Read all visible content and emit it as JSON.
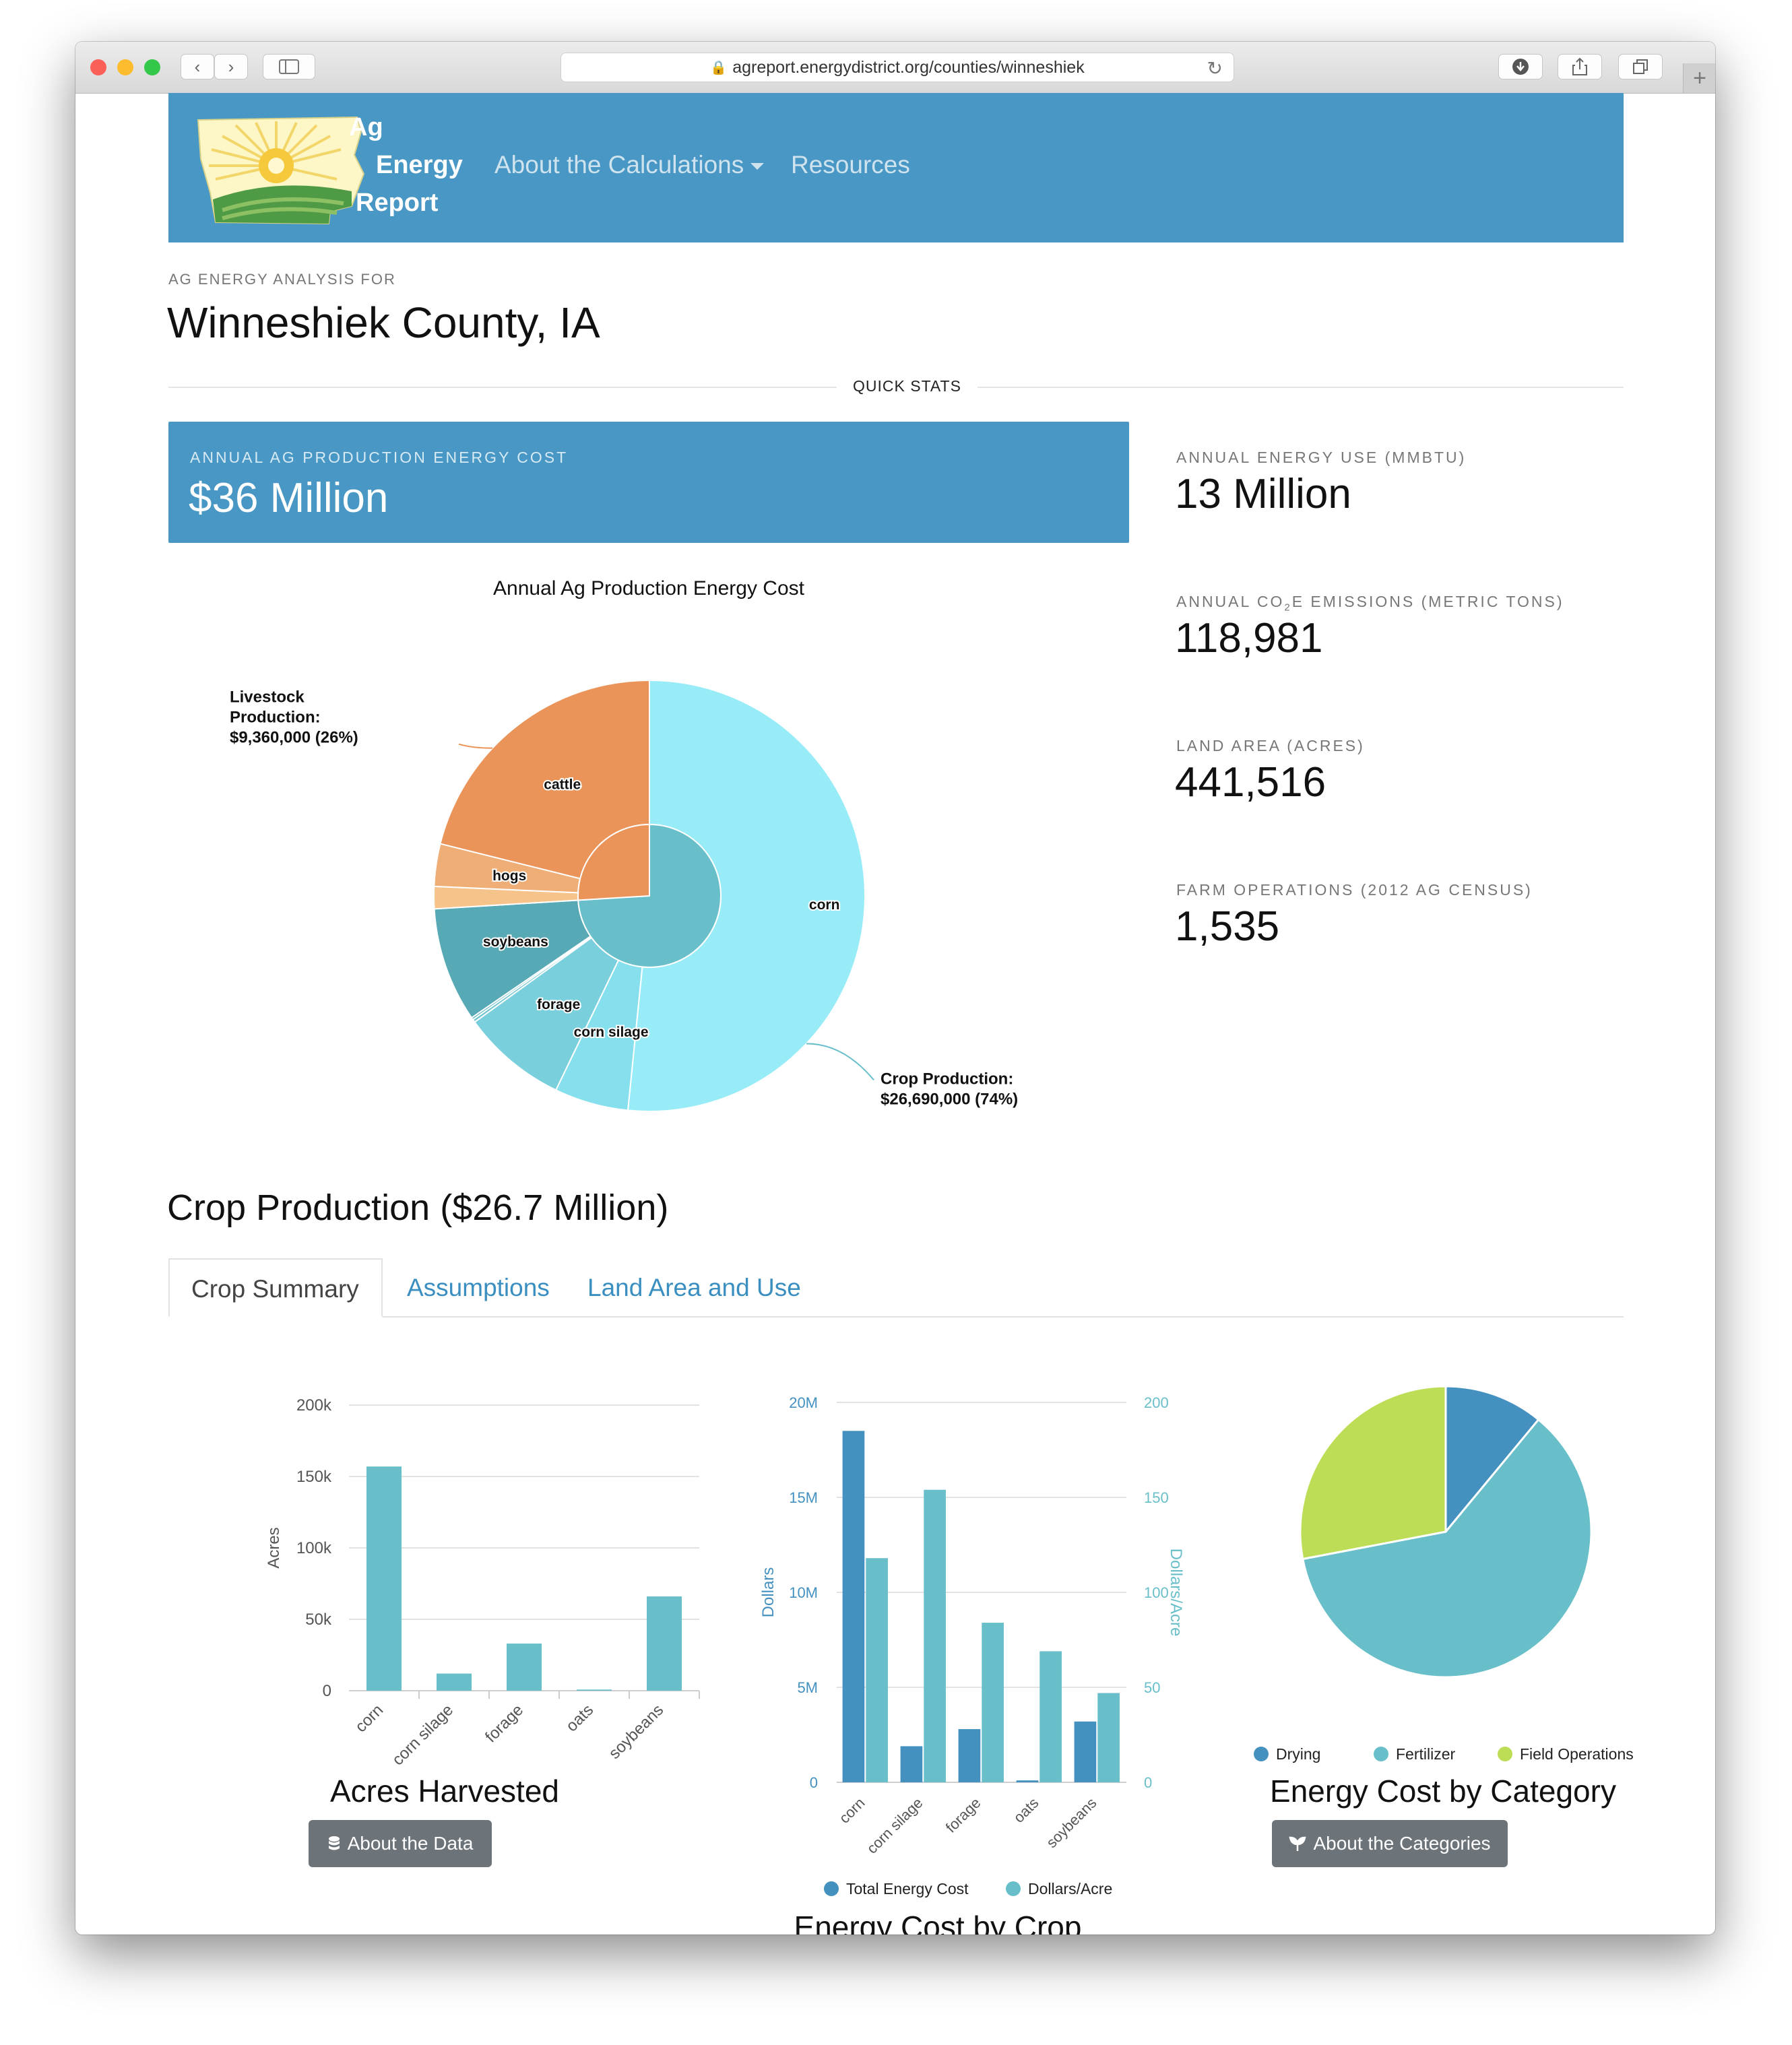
{
  "browser": {
    "url": "agreport.energydistrict.org/counties/winneshiek"
  },
  "nav": {
    "logo_words": [
      "Ag",
      "Energy",
      "Report"
    ],
    "links": [
      {
        "label": "About the Calculations"
      },
      {
        "label": "Resources"
      }
    ]
  },
  "header": {
    "kicker": "AG ENERGY ANALYSIS FOR",
    "title": "Winneshiek County, IA",
    "quick_stats_label": "QUICK STATS"
  },
  "cost_banner": {
    "label": "ANNUAL AG PRODUCTION ENERGY COST",
    "value": "$36 Million"
  },
  "stats": [
    {
      "label": "ANNUAL ENERGY USE (MMBTU)",
      "value": "13 Million"
    },
    {
      "label_parts": [
        "ANNUAL CO",
        "2",
        "E EMISSIONS (METRIC TONS)"
      ],
      "value": "118,981"
    },
    {
      "label": "LAND AREA (ACRES)",
      "value": "441,516"
    },
    {
      "label": "FARM OPERATIONS (2012 AG CENSUS)",
      "value": "1,535"
    }
  ],
  "crop_section": {
    "title": "Crop Production ($26.7 Million)",
    "tabs": [
      {
        "label": "Crop Summary",
        "active": true
      },
      {
        "label": "Assumptions",
        "active": false
      },
      {
        "label": "Land Area and Use",
        "active": false
      }
    ],
    "acres_caption": "Acres Harvested",
    "about_data_button": "About the Data",
    "energy_crop_caption": "Energy Cost by Crop",
    "category_caption": "Energy Cost by Category",
    "about_categories_button": "About the Categories"
  },
  "colors": {
    "brand_blue": "#4897c4",
    "teal": "#68bfc9",
    "dark_blue": "#4491c0",
    "lime": "#bddd56",
    "orange": "#ea9459",
    "light_cyan": "#98ecf8"
  },
  "chart_data": [
    {
      "type": "pie",
      "title": "Annual Ag Production Energy Cost",
      "inner": [
        {
          "name": "Crop Production",
          "value": 26690000,
          "label": "Crop Production:\n$26,690,000 (74%)"
        },
        {
          "name": "Livestock Production",
          "value": 9360000,
          "label": "Livestock\nProduction:\n$9,360,000 (26%)"
        }
      ],
      "outer": [
        {
          "name": "corn",
          "group": "Crop Production",
          "value": 18600000,
          "labeled": true
        },
        {
          "name": "corn silage",
          "group": "Crop Production",
          "value": 2000000,
          "labeled": true
        },
        {
          "name": "forage",
          "group": "Crop Production",
          "value": 2850000,
          "labeled": true
        },
        {
          "name": "oats",
          "group": "Crop Production",
          "value": 80000,
          "labeled": false
        },
        {
          "name": "",
          "group": "Crop Production",
          "value": 60000,
          "labeled": false
        },
        {
          "name": "soybeans",
          "group": "Crop Production",
          "value": 3100000,
          "labeled": true
        },
        {
          "name": "",
          "group": "Livestock Production",
          "value": 600000,
          "labeled": false
        },
        {
          "name": "hogs",
          "group": "Livestock Production",
          "value": 1150000,
          "labeled": true
        },
        {
          "name": "cattle",
          "group": "Livestock Production",
          "value": 7610000,
          "labeled": true
        }
      ]
    },
    {
      "type": "bar",
      "categories": [
        "corn",
        "corn silage",
        "forage",
        "oats",
        "soybeans"
      ],
      "values": [
        157000,
        12000,
        33000,
        800,
        66000
      ],
      "ylabel": "Acres",
      "ylim": [
        0,
        200000
      ],
      "yticks": [
        "0",
        "50k",
        "100k",
        "150k",
        "200k"
      ]
    },
    {
      "type": "bar",
      "categories": [
        "corn",
        "corn silage",
        "forage",
        "oats",
        "soybeans"
      ],
      "series": [
        {
          "name": "Total Energy Cost",
          "axis": "left",
          "values": [
            18500000,
            1900000,
            2800000,
            100000,
            3200000
          ]
        },
        {
          "name": "Dollars/Acre",
          "axis": "right",
          "values": [
            118,
            154,
            84,
            69,
            47
          ]
        }
      ],
      "ylabel_left": "Dollars",
      "ylabel_right": "Dollars/Acre",
      "ylim_left": [
        0,
        20000000
      ],
      "ylim_right": [
        0,
        200
      ],
      "yticks_left": [
        "0",
        "5M",
        "10M",
        "15M",
        "20M"
      ],
      "yticks_right": [
        "0",
        "50",
        "100",
        "150",
        "200"
      ]
    },
    {
      "type": "pie",
      "slices": [
        {
          "name": "Drying",
          "value": 11
        },
        {
          "name": "Fertilizer",
          "value": 61
        },
        {
          "name": "Field Operations",
          "value": 28
        }
      ],
      "legend": "bottom"
    }
  ]
}
